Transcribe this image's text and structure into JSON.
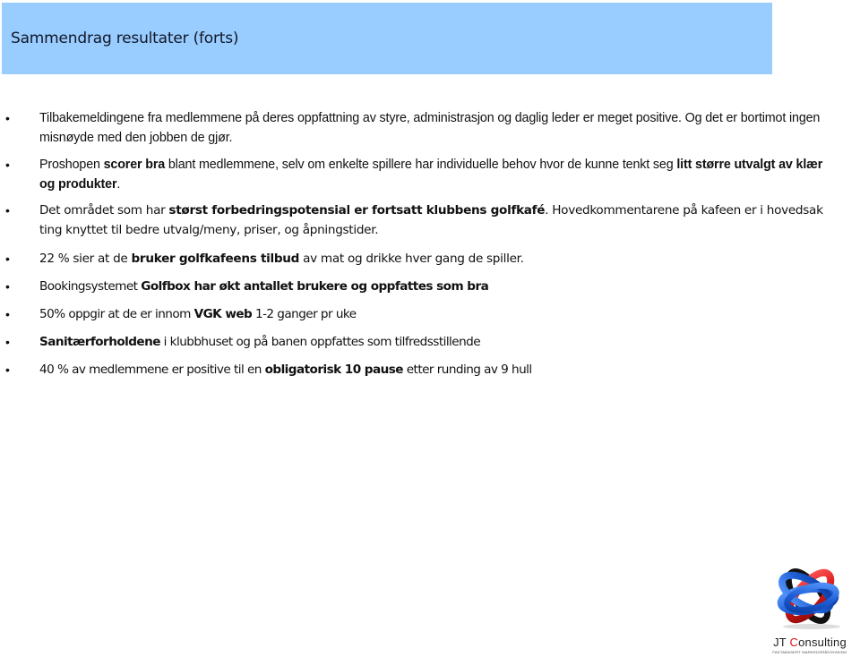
{
  "header": {
    "title": "Sammendrag resultater (forts)",
    "background_color": "#99ccff"
  },
  "bullets": [
    {
      "segments": [
        {
          "text": "Tilbakemeldingene fra medlemmene på deres oppfattning av styre, administrasjon og daglig leder er  meget positive. Og det er bortimot ingen misnøyde med den jobben de gjør.",
          "bold": false
        }
      ]
    },
    {
      "segments": [
        {
          "text": "Proshopen ",
          "bold": false
        },
        {
          "text": "scorer bra",
          "bold": true
        },
        {
          "text": " blant medlemmene, selv om enkelte spillere har individuelle behov hvor de  kunne tenkt seg ",
          "bold": false
        },
        {
          "text": "litt større utvalgt av klær og produkter",
          "bold": true
        },
        {
          "text": ".",
          "bold": false
        }
      ]
    },
    {
      "segments": [
        {
          "text": "Det området som har ",
          "bold": false
        },
        {
          "text": "størst forbedringspotensial er  fortsatt klubbens golfkafé",
          "bold": true
        },
        {
          "text": ". Hovedkommentarene på kafeen er i hovedsak ting knyttet til  bedre utvalg/meny,  priser, og åpningstider.",
          "bold": false
        }
      ]
    },
    {
      "segments": [
        {
          "text": "22 % sier at de ",
          "bold": false
        },
        {
          "text": "bruker golfkafeens tilbud",
          "bold": true
        },
        {
          "text": " av mat og drikke hver gang de spiller.",
          "bold": false
        }
      ]
    },
    {
      "segments": [
        {
          "text": "Bookingsystemet ",
          "bold": false
        },
        {
          "text": "Golfbox  har økt antallet brukere og oppfattes som bra",
          "bold": true
        }
      ]
    },
    {
      "segments": [
        {
          "text": "50% oppgir at de er innom ",
          "bold": false
        },
        {
          "text": "VGK web",
          "bold": true
        },
        {
          "text": " 1-2 ganger pr uke",
          "bold": false
        }
      ]
    },
    {
      "segments": [
        {
          "text": "Sanitærforholdene",
          "bold": true
        },
        {
          "text": " i klubbhuset og på banen oppfattes som tilfredsstillende",
          "bold": false
        }
      ]
    },
    {
      "segments": [
        {
          "text": "40 % av medlemmene er positive til en ",
          "bold": false
        },
        {
          "text": "obligatorisk 10 pause",
          "bold": true
        },
        {
          "text": " etter runding av 9 hull",
          "bold": false
        }
      ]
    }
  ],
  "bullet_glyph": "•",
  "logo": {
    "icon": "interlocked-rings-icon",
    "name_prefix": "JT ",
    "name_accent": "C",
    "name_suffix": "onsulting",
    "tagline": "FAKTABASERT MARKEDSRÅDGIVNING",
    "colors": {
      "blue": "#1f5fd6",
      "red": "#d81818",
      "black": "#111111"
    }
  }
}
